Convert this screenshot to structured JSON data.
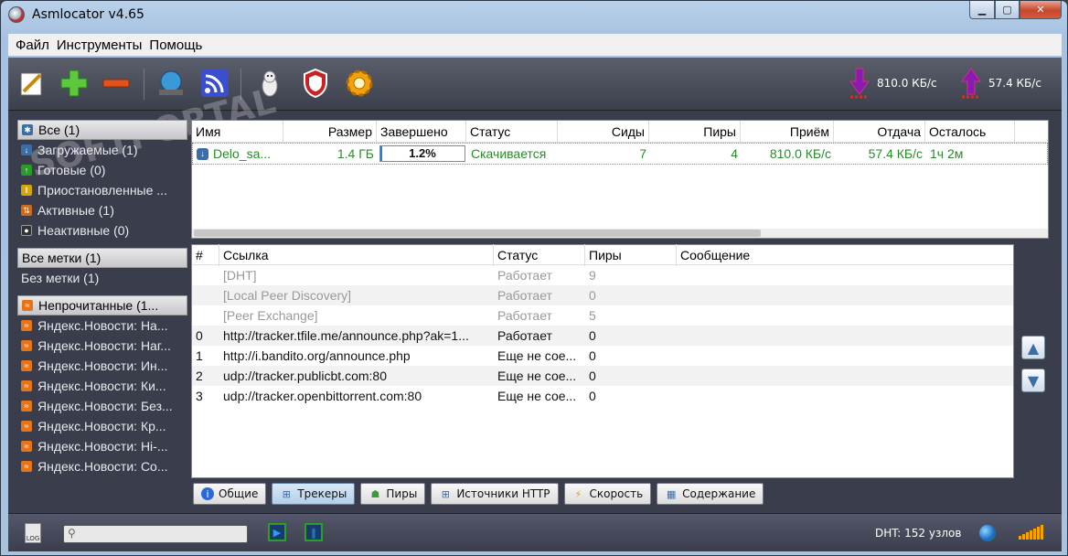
{
  "window": {
    "title": "Asmlocator v4.65"
  },
  "menu": [
    "Файл",
    "Инструменты",
    "Помощь"
  ],
  "toolbar": {
    "download_speed": "810.0 КБ/с",
    "upload_speed": "57.4 КБ/с"
  },
  "sidebar": {
    "status_filters": [
      {
        "label": "Все (1)",
        "color": "#3a6ea5"
      },
      {
        "label": "Загружаемые (1)",
        "color": "#3a6ea5"
      },
      {
        "label": "Готовые (0)",
        "color": "#2a9a2a"
      },
      {
        "label": "Приостановленные ...",
        "color": "#d9a400"
      },
      {
        "label": "Активные (1)",
        "color": "#d06a1a"
      },
      {
        "label": "Неактивные (0)",
        "color": "#333333"
      }
    ],
    "labels": [
      "Все метки (1)",
      "Без метки (1)"
    ],
    "feeds": [
      "Непрочитанные  (1...",
      "Яндекс.Новости: На...",
      "Яндекс.Новости: Наг...",
      "Яндекс.Новости: Ин...",
      "Яндекс.Новости: Ки...",
      "Яндекс.Новости: Без...",
      "Яндекс.Новости: Кр...",
      "Яндекс.Новости: Hi-...",
      "Яндекс.Новости: Со..."
    ]
  },
  "torrents": {
    "columns": [
      "Имя",
      "Размер",
      "Завершено",
      "Статус",
      "Сиды",
      "Пиры",
      "Приём",
      "Отдача",
      "Осталось"
    ],
    "rows": [
      {
        "name": "Delo_sa...",
        "size": "1.4 ГБ",
        "done": "1.2%",
        "status": "Скачивается",
        "seeds": "7",
        "peers": "4",
        "down": "810.0 КБ/с",
        "up": "57.4 КБ/с",
        "eta": "1ч 2м"
      }
    ]
  },
  "trackers": {
    "columns": [
      "#",
      "Ссылка",
      "Статус",
      "Пиры",
      "Сообщение"
    ],
    "rows": [
      {
        "num": "",
        "url": "[DHT]",
        "status": "Работает",
        "peers": "9",
        "msg": "",
        "dim": true
      },
      {
        "num": "",
        "url": "[Local Peer Discovery]",
        "status": "Работает",
        "peers": "0",
        "msg": "",
        "dim": true
      },
      {
        "num": "",
        "url": "[Peer Exchange]",
        "status": "Работает",
        "peers": "5",
        "msg": "",
        "dim": true
      },
      {
        "num": "0",
        "url": "http://tracker.tfile.me/announce.php?ak=1...",
        "status": "Работает",
        "peers": "0",
        "msg": "",
        "dim": false
      },
      {
        "num": "1",
        "url": "http://i.bandito.org/announce.php",
        "status": "Еще не сое...",
        "peers": "0",
        "msg": "",
        "dim": false
      },
      {
        "num": "2",
        "url": "udp://tracker.publicbt.com:80",
        "status": "Еще не сое...",
        "peers": "0",
        "msg": "",
        "dim": false
      },
      {
        "num": "3",
        "url": "udp://tracker.openbittorrent.com:80",
        "status": "Еще не сое...",
        "peers": "0",
        "msg": "",
        "dim": false
      }
    ]
  },
  "tabs": [
    "Общие",
    "Трекеры",
    "Пиры",
    "Источники HTTP",
    "Скорость",
    "Содержание"
  ],
  "statusbar": {
    "dht": "DHT: 152 узлов"
  }
}
